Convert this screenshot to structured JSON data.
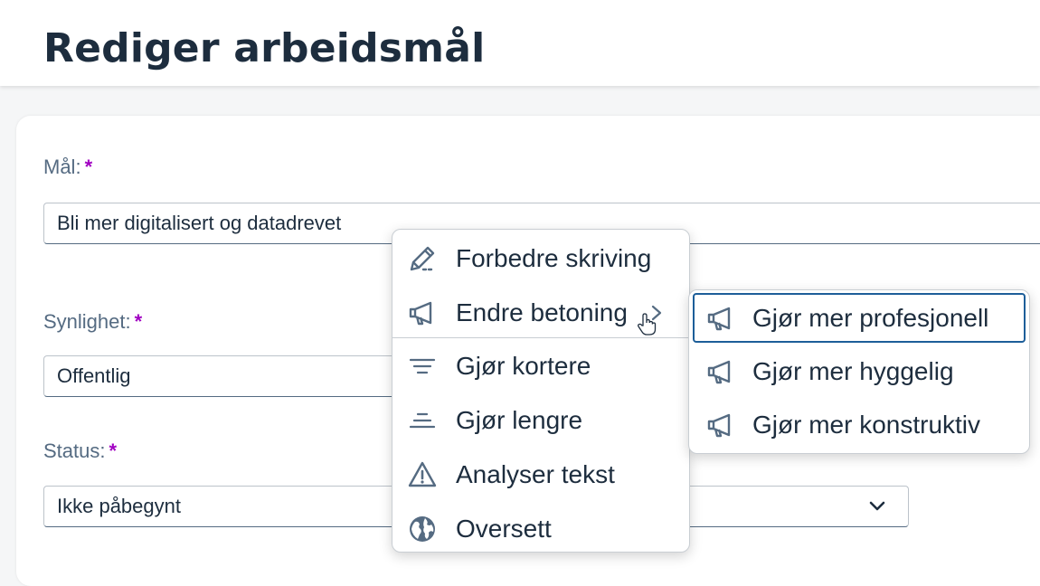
{
  "page": {
    "title": "Rediger arbeidsmål"
  },
  "form": {
    "goal": {
      "label": "Mål:",
      "required_mark": "*",
      "value": "Bli mer digitalisert og datadrevet"
    },
    "visibility": {
      "label": "Synlighet:",
      "required_mark": "*",
      "value": "Offentlig"
    },
    "status": {
      "label": "Status:",
      "required_mark": "*",
      "value": "Ikke påbegynt"
    }
  },
  "ai_menu": {
    "items": [
      {
        "label": "Forbedre skriving",
        "icon": "pencil-icon"
      },
      {
        "label": "Endre betoning",
        "icon": "megaphone-icon",
        "has_submenu": true
      },
      {
        "label": "Gjør kortere",
        "icon": "shorten-icon"
      },
      {
        "label": "Gjør lengre",
        "icon": "lengthen-icon"
      },
      {
        "label": "Analyser tekst",
        "icon": "warning-icon"
      },
      {
        "label": "Oversett",
        "icon": "globe-icon"
      }
    ]
  },
  "tone_submenu": {
    "items": [
      {
        "label": "Gjør mer profesjonell",
        "icon": "megaphone-icon",
        "focused": true
      },
      {
        "label": "Gjør mer hyggelig",
        "icon": "megaphone-icon"
      },
      {
        "label": "Gjør mer konstruktiv",
        "icon": "megaphone-icon"
      }
    ]
  },
  "colors": {
    "text": "#1d2d3e",
    "icon": "#556b82",
    "required": "#a100c2",
    "focus": "#1d5e99"
  }
}
